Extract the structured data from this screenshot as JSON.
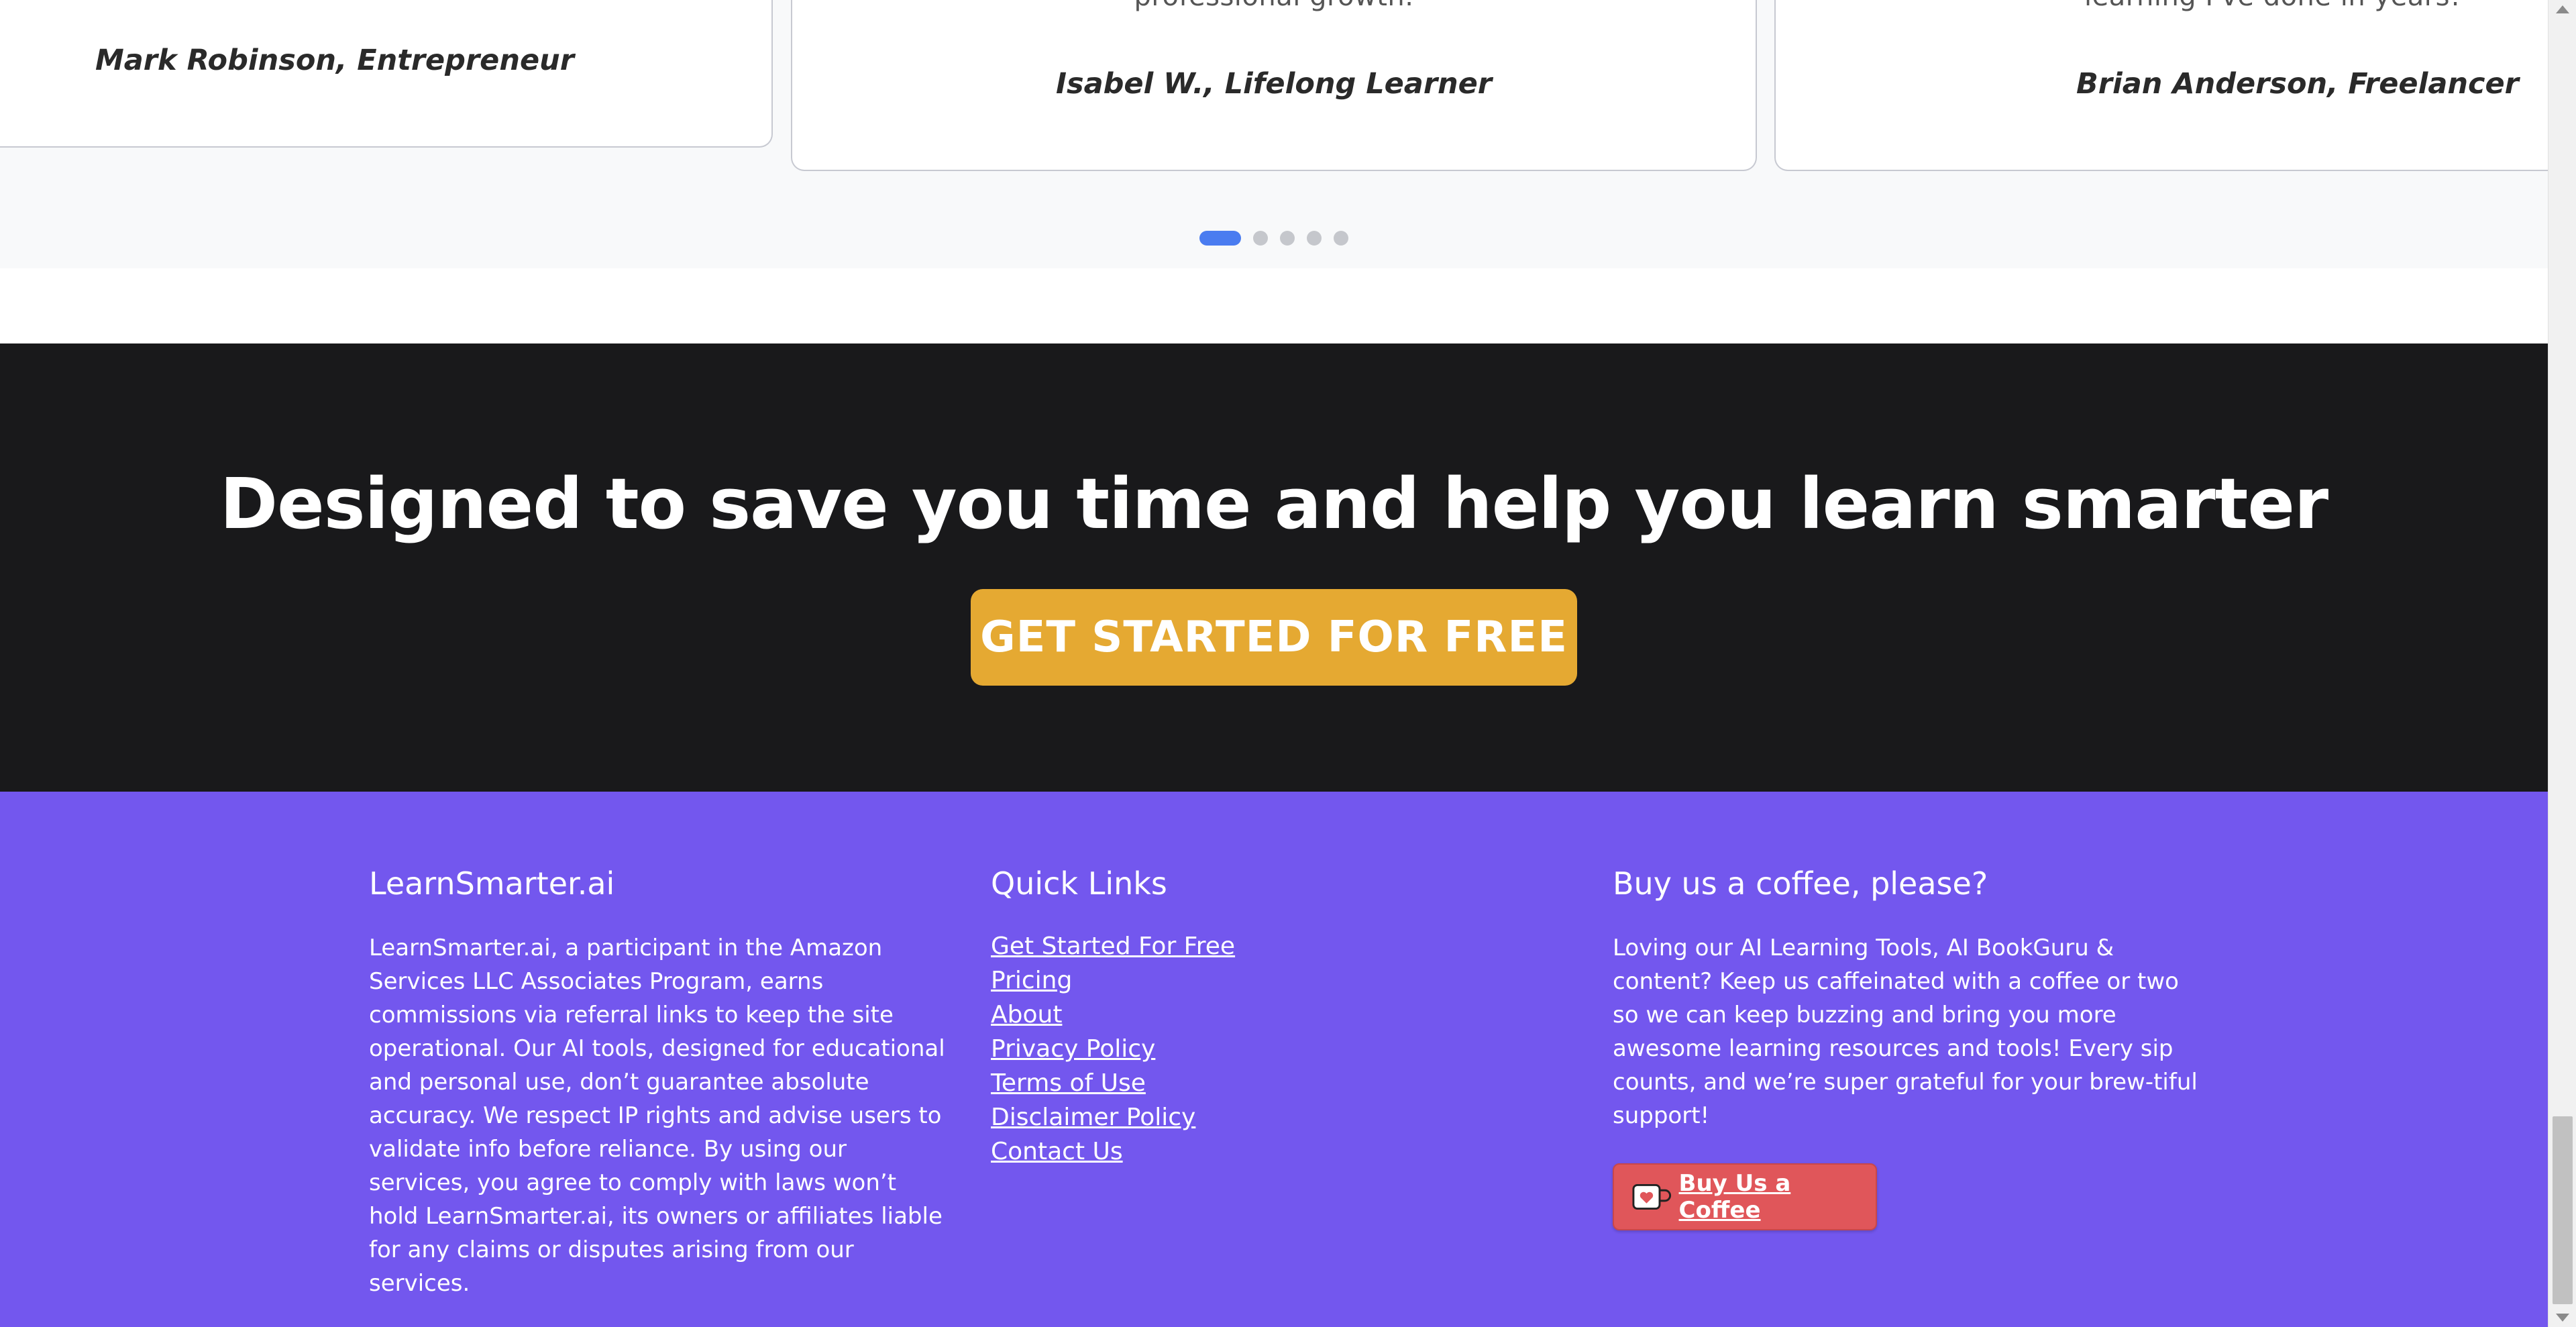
{
  "testimonials": {
    "cards": [
      {
        "quote_tail": "",
        "author": "Mark Robinson, Entrepreneur"
      },
      {
        "quote_tail": "professional growth.",
        "author": "Isabel W., Lifelong Learner"
      },
      {
        "quote_tail": "learning I've done in years!",
        "author": "Brian Anderson, Freelancer"
      }
    ],
    "active_slide": 1,
    "slide_count": 5
  },
  "cta": {
    "title": "Designed to save you time and help you learn smarter",
    "button_label": "GET STARTED FOR FREE"
  },
  "footer": {
    "about": {
      "title": "LearnSmarter.ai",
      "text": "LearnSmarter.ai, a participant in the Amazon Services LLC Associates Program, earns commissions via referral links to keep the site operational. Our AI tools, designed for educational and personal use, don’t guarantee absolute accuracy. We respect IP rights and advise users to validate info before reliance. By using our services, you agree to comply with laws won’t hold LearnSmarter.ai, its owners or affiliates liable for any claims or disputes arising from our services."
    },
    "quick_links": {
      "title": "Quick Links",
      "items": [
        "Get Started For Free",
        "Pricing",
        "About",
        "Privacy Policy",
        "Terms of Use",
        "Disclaimer Policy",
        "Contact Us"
      ]
    },
    "coffee": {
      "title": "Buy us a coffee, please?",
      "text": "Loving our AI Learning Tools, AI BookGuru & content? Keep us caffeinated with a coffee or two so we can keep buzzing and bring you more awesome learning resources and tools! Every sip counts, and we’re super grateful for your brew-tiful support!",
      "button_label": "Buy Us a Coffee"
    }
  },
  "colors": {
    "cta_bg": "#19191b",
    "cta_button": "#e5a932",
    "footer_bg": "#7357ee",
    "dot_active": "#4a7cf0",
    "coffee_button": "#e0565a"
  }
}
